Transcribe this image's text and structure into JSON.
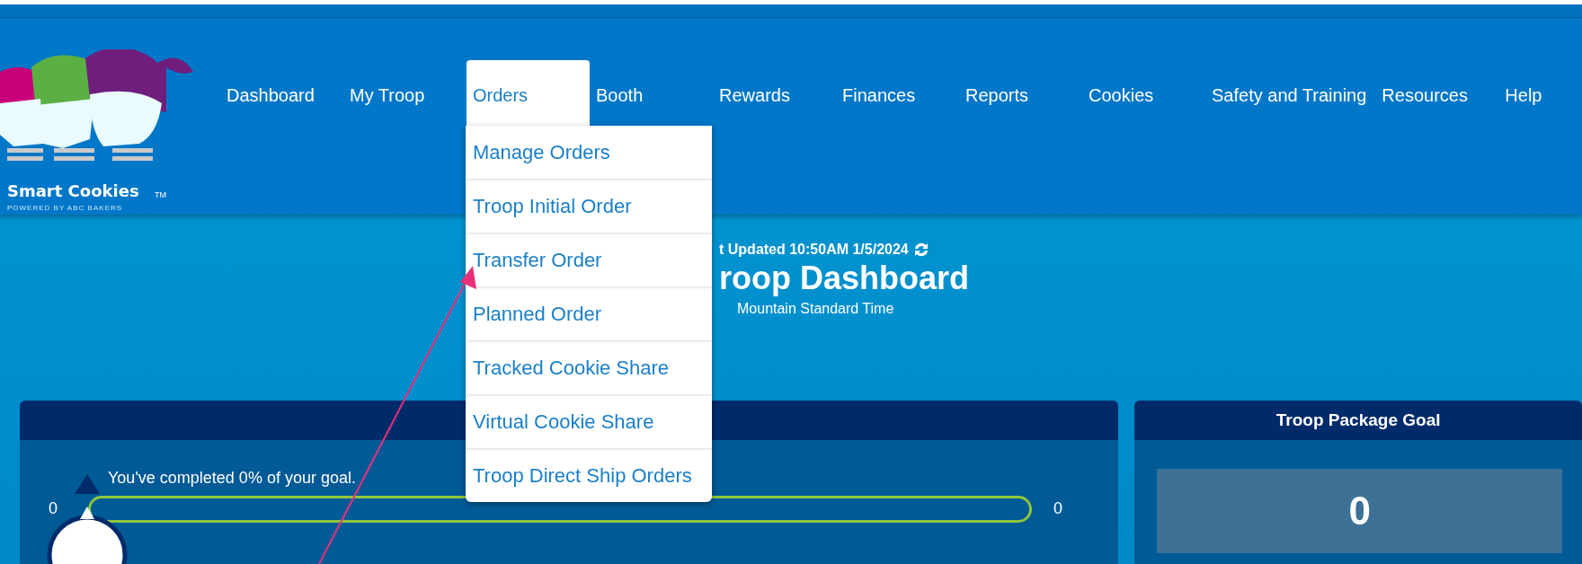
{
  "logo": {
    "name": "Smart Cookies",
    "trademark": "TM",
    "tagline": "POWERED BY ABC BAKERS"
  },
  "nav": [
    {
      "label": "Dashboard",
      "selected": false
    },
    {
      "label": "My Troop",
      "selected": false
    },
    {
      "label": "Orders",
      "selected": true
    },
    {
      "label": "Booth",
      "selected": false
    },
    {
      "label": "Rewards",
      "selected": false
    },
    {
      "label": "Finances",
      "selected": false
    },
    {
      "label": "Reports",
      "selected": false
    },
    {
      "label": "Cookies",
      "selected": false
    },
    {
      "label": "Safety and Training",
      "selected": false
    },
    {
      "label": "Resources",
      "selected": false
    },
    {
      "label": "Help",
      "selected": false
    }
  ],
  "orders_menu": [
    "Manage Orders",
    "Troop Initial Order",
    "Transfer Order",
    "Planned Order",
    "Tracked Cookie Share",
    "Virtual Cookie Share",
    "Troop Direct Ship Orders"
  ],
  "header": {
    "updated": "t Updated 10:50AM 1/5/2024",
    "title": "roop Dashboard",
    "timezone": "Mountain Standard Time"
  },
  "progress_card": {
    "message": "You've completed 0% of your goal.",
    "min": "0",
    "max": "0",
    "level": 0
  },
  "goal_card": {
    "title": "Troop Package Goal",
    "value": "0"
  }
}
